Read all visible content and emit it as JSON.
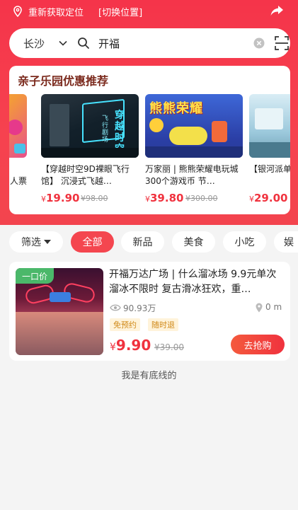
{
  "topbar": {
    "relocate": "重新获取定位",
    "switch": "[切换位置]"
  },
  "search": {
    "city": "长沙",
    "query": "开福"
  },
  "promo": {
    "title": "亲子乐园优惠推荐",
    "items": [
      {
        "name": "人票\n卡…",
        "price_symbol": "",
        "price": "",
        "orig": ""
      },
      {
        "name": "【穿越时空9D裸眼飞行馆】 沉浸式飞越…",
        "price_symbol": "¥",
        "price": "19.90",
        "orig": "¥98.00"
      },
      {
        "name": "万家丽 | 熊熊荣耀电玩城 300个游戏币 节…",
        "price_symbol": "¥",
        "price": "39.80",
        "orig": "¥300.00"
      },
      {
        "name": "【银河派单人畅玩",
        "price_symbol": "¥",
        "price": "29.00",
        "orig": ""
      }
    ]
  },
  "filters": [
    {
      "label": "筛选"
    },
    {
      "label": "全部"
    },
    {
      "label": "新品"
    },
    {
      "label": "美食"
    },
    {
      "label": "小吃"
    },
    {
      "label": "娱"
    }
  ],
  "listing": {
    "tag": "一口价",
    "title": "开福万达广场 | 什么溜冰场 9.9元单次溜冰不限时 复古滑冰狂欢，重…",
    "views": "90.93万",
    "distance": "0 m",
    "badges": [
      "免预约",
      "随时退"
    ],
    "price_symbol": "¥",
    "price": "9.90",
    "orig": "¥39.00",
    "buy": "去抢购"
  },
  "footer": "我是有底线的",
  "colors": {
    "brand_red": "#f4464f",
    "price_red": "#f0323e",
    "tag_green": "#4bb86a"
  }
}
